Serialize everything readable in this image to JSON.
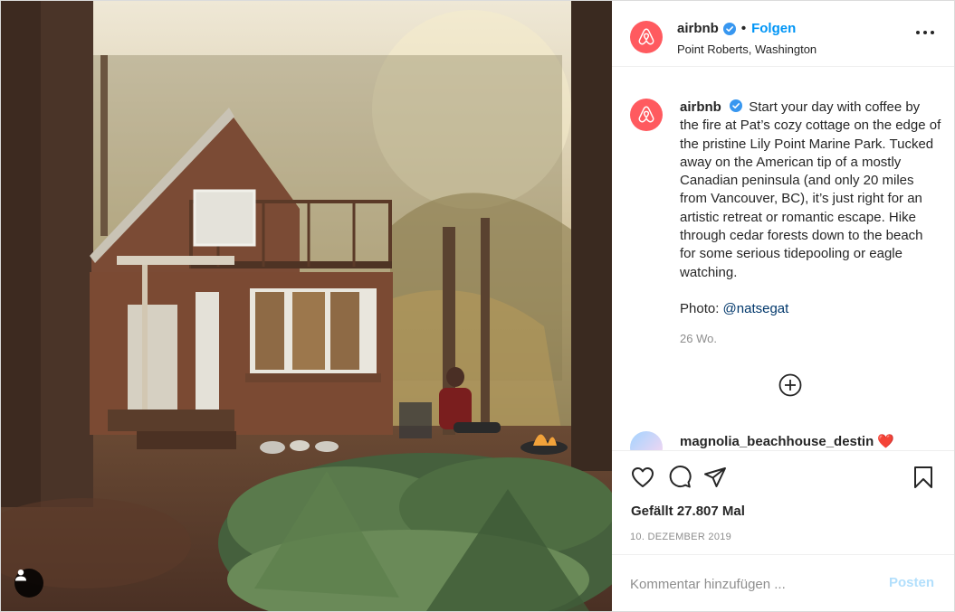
{
  "account": {
    "username": "airbnb",
    "follow_label": "Folgen",
    "separator": "•",
    "location": "Point Roberts, Washington",
    "brand_color": "#ff5a5f",
    "verified_color": "#3897f0"
  },
  "caption": {
    "username": "airbnb",
    "text": "Start your day with coffee by the fire at Pat’s cozy cottage on the edge of the pristine Lily Point Marine Park. Tucked away on the American tip of a mostly Canadian peninsula (and only 20 miles from Vancouver, BC), it’s just right for an artistic retreat or romantic escape. Hike through cedar forests down to the beach for some serious tidepooling or eagle watching.",
    "photo_label": "Photo:",
    "photo_credit": "@natsegat",
    "age": "26 Wo."
  },
  "next_comment": {
    "username": "magnolia_beachhouse_destin",
    "emoji": "❤️"
  },
  "actions": {
    "likes": "Gefällt 27.807 Mal",
    "date": "10. DEZEMBER 2019"
  },
  "comment_box": {
    "placeholder": "Kommentar hinzufügen ...",
    "post_label": "Posten"
  },
  "icons": {
    "like": "heart-icon",
    "comment": "comment-bubble-icon",
    "share": "paper-plane-icon",
    "save": "bookmark-icon",
    "more": "more-options-icon",
    "load_more": "plus-circle-icon",
    "user_tag": "user-tag-icon"
  }
}
